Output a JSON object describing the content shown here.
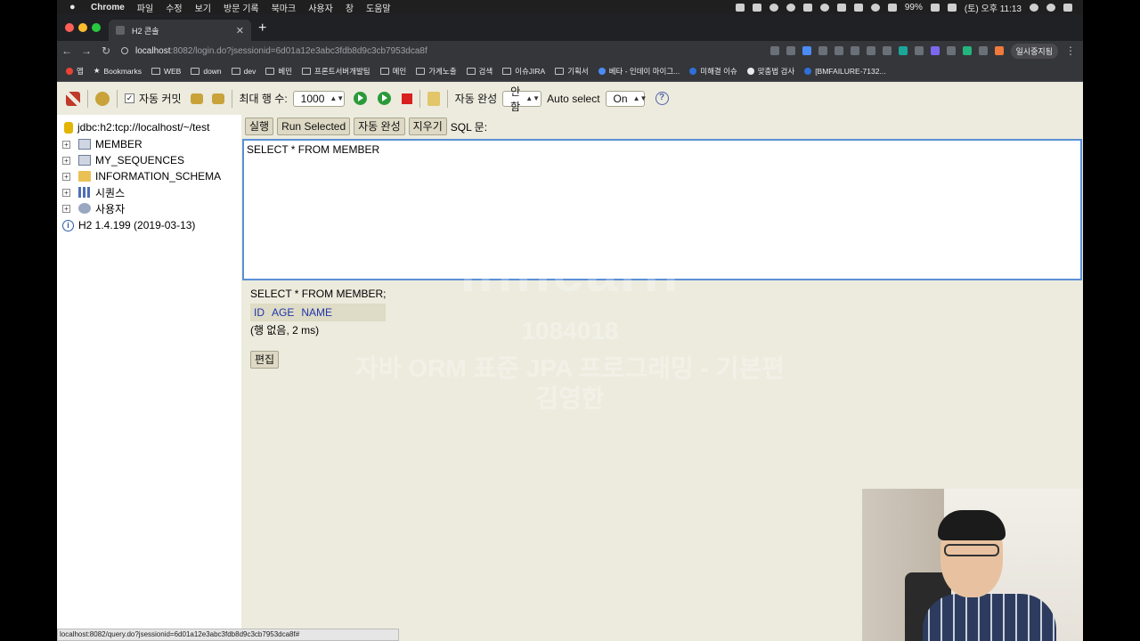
{
  "menubar": {
    "app": "Chrome",
    "menus": [
      "파일",
      "수정",
      "보기",
      "방문 기록",
      "북마크",
      "사용자",
      "창",
      "도움말"
    ],
    "battery": "99%",
    "clock": "(토) 오후 11:13"
  },
  "tab": {
    "title": "H2 콘솔"
  },
  "address": {
    "host": "localhost",
    "path": ":8082/login.do?jsessionid=6d01a12e3abc3fdb8d9c3cb7953dca8f"
  },
  "profile": "일시중지됨",
  "bookmarks": [
    "앱",
    "Bookmarks",
    "WEB",
    "down",
    "dev",
    "베민",
    "프론트서버개발팀",
    "메인",
    "가게노출",
    "검색",
    "이슈JIRA",
    "기획서",
    "베타 - 인데이 마이그...",
    "미해결 이슈",
    "맞춤법 검사",
    "[BMFAILURE-7132..."
  ],
  "h2toolbar": {
    "auto_commit": "자동 커밋",
    "max_rows_label": "최대 행 수:",
    "max_rows_value": "1000",
    "autocomplete_label": "자동 완성",
    "autocomplete_value": "안함",
    "auto_select_label": "Auto select",
    "auto_select_value": "On",
    "help": "?"
  },
  "tree": {
    "connection": "jdbc:h2:tcp://localhost/~/test",
    "items": [
      "MEMBER",
      "MY_SEQUENCES",
      "INFORMATION_SCHEMA",
      "시퀀스",
      "사용자"
    ],
    "version": "H2 1.4.199 (2019-03-13)"
  },
  "sqlbar": {
    "execute": "실행",
    "run_selected": "Run Selected",
    "autocomplete": "자동 완성",
    "clear": "지우기",
    "sql_label": "SQL 문:"
  },
  "editor": {
    "text": "SELECT * FROM MEMBER"
  },
  "result": {
    "statement": "SELECT * FROM MEMBER;",
    "columns": [
      "ID",
      "AGE",
      "NAME"
    ],
    "info": "(행 없음, 2 ms)",
    "edit": "편집"
  },
  "watermark": {
    "logo": "inflearn",
    "code": "1084018",
    "course": "자바 ORM 표준 JPA 프로그래밍 - 기본편",
    "author": "김영한"
  },
  "status_url": "localhost:8082/query.do?jsessionid=6d01a12e3abc3fdb8d9c3cb7953dca8f#"
}
